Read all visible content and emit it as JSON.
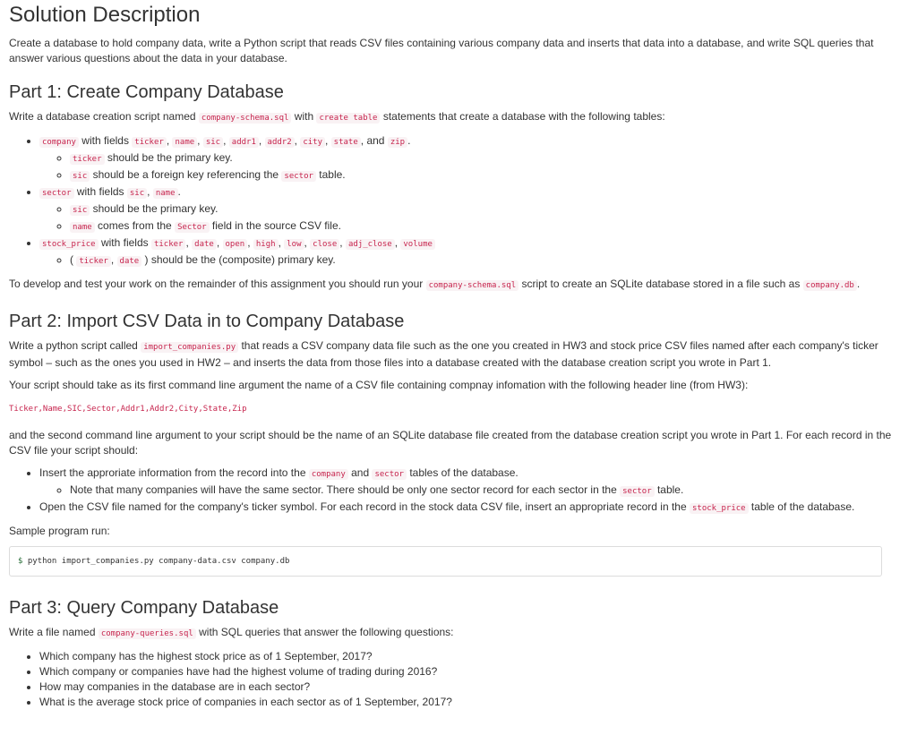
{
  "title": "Solution Description",
  "intro": "Create a database to hold company data, write a Python script that reads CSV files containing various company data and inserts that data into a database, and write SQL queries that answer various questions about the data in your database.",
  "part1": {
    "heading": "Part 1: Create Company Database",
    "p1_a": "Write a database creation script named ",
    "p1_code1": "company-schema.sql",
    "p1_b": " with ",
    "p1_code2": "create table",
    "p1_c": " statements that create a database with the following tables:",
    "company": {
      "name": "company",
      "with_fields": " with fields ",
      "fields": [
        "ticker",
        "name",
        "sic",
        "addr1",
        "addr2",
        "city",
        "state",
        "zip"
      ],
      "and": "and",
      "sub": [
        {
          "code": "ticker",
          "text": " should be the primary key."
        },
        {
          "code": "sic",
          "text": " should be a foreign key referencing the ",
          "code2": "sector",
          "text2": " table."
        }
      ]
    },
    "sector": {
      "name": "sector",
      "with_fields": " with fields ",
      "fields": [
        "sic",
        "name"
      ],
      "sub": [
        {
          "code": "sic",
          "text": " should be the primary key."
        },
        {
          "code": "name",
          "text": " comes from the ",
          "code2": "Sector",
          "text2": " field in the source CSV file."
        }
      ]
    },
    "stock_price": {
      "name": "stock_price",
      "with_fields": " with fields ",
      "fields": [
        "ticker",
        "date",
        "open",
        "high",
        "low",
        "close",
        "adj_close",
        "volume"
      ],
      "sub": [
        {
          "pre": "( ",
          "code": "ticker",
          "sep": ", ",
          "code2": "date",
          "text": " ) should be the (composite) primary key."
        }
      ]
    },
    "p2_a": "To develop and test your work on the remainder of this assignment you should run your ",
    "p2_code1": "company-schema.sql",
    "p2_b": " script to create an SQLite database stored in a file such as ",
    "p2_code2": "company.db",
    "p2_c": "."
  },
  "part2": {
    "heading": "Part 2: Import CSV Data in to Company Database",
    "p1_a": "Write a python script called ",
    "p1_code": "import_companies.py",
    "p1_b": " that reads a CSV company data file such as the one you created in HW3 and stock price CSV files named after each company's ticker symbol – such as the ones you used in HW2 – and inserts the data from those files into a database created with the database creation script you wrote in Part 1.",
    "p2": "Your script should take as its first command line argument the name of a CSV file containing compnay infomation with the following header line (from HW3):",
    "header_line": "Ticker,Name,SIC,Sector,Addr1,Addr2,City,State,Zip",
    "p3": "and the second command line argument to your script should be the name of an SQLite database file created from the database creation script you wrote in Part 1. For each record in the CSV file your script should:",
    "b1_a": "Insert the approriate information from the record into the ",
    "b1_code1": "company",
    "b1_b": " and ",
    "b1_code2": "sector",
    "b1_c": " tables of the database.",
    "b1_sub_a": "Note that many companies will have the same sector. There should be only one sector record for each sector in the ",
    "b1_sub_code": "sector",
    "b1_sub_b": " table.",
    "b2_a": "Open the CSV file named for the company's ticker symbol. For each record in the stock data CSV file, insert an appropriate record in the ",
    "b2_code": "stock_price",
    "b2_b": " table of the database.",
    "sample_label": "Sample program run:",
    "sample_prompt": "$",
    "sample_cmd": " python import_companies.py company-data.csv company.db"
  },
  "part3": {
    "heading": "Part 3: Query Company Database",
    "p1_a": "Write a file named ",
    "p1_code": "company-queries.sql",
    "p1_b": " with SQL queries that answer the following questions:",
    "questions": [
      "Which company has the highest stock price as of 1 September, 2017?",
      "Which company or companies have had the highest volume of trading during 2016?",
      "How may companies in the database are in each sector?",
      "What is the average stock price of companies in each sector as of 1 September, 2017?"
    ]
  }
}
